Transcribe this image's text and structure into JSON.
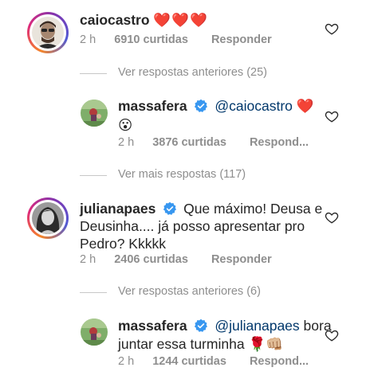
{
  "comments": [
    {
      "username": "caiocastro",
      "text": "❤️❤️❤️",
      "time": "2 h",
      "likes": "6910 curtidas",
      "reply": "Responder",
      "verified": false
    },
    {
      "more": "Ver respostas anteriores (25)"
    },
    {
      "username": "massafera",
      "mention": "@caiocastro",
      "text": "❤️",
      "line2": "😮",
      "time": "2 h",
      "likes": "3876 curtidas",
      "reply": "Respond...",
      "verified": true
    },
    {
      "more": "Ver mais respostas (117)"
    },
    {
      "username": "julianapaes",
      "text": "Que máximo! Deusa e",
      "line2": "Deusinha.... já posso apresentar pro",
      "line3": "Pedro? Kkkkk",
      "time": "2 h",
      "likes": "2406 curtidas",
      "reply": "Responder",
      "verified": true
    },
    {
      "more": "Ver respostas anteriores (6)"
    },
    {
      "username": "massafera",
      "mention": "@julianapaes",
      "text": "bora",
      "line2": "juntar essa turminha",
      "emojis": "🌹👊🏼",
      "time": "2 h",
      "likes": "1244 curtidas",
      "reply": "Respond...",
      "verified": true
    }
  ],
  "colors": {
    "text": "#262626",
    "meta": "#8e8e8e",
    "mention": "#00376b",
    "verified": "#3897f0",
    "heart_red": "#ed4956"
  },
  "icons": {
    "like": "heart-outline-icon",
    "verified": "verified-badge-icon"
  }
}
